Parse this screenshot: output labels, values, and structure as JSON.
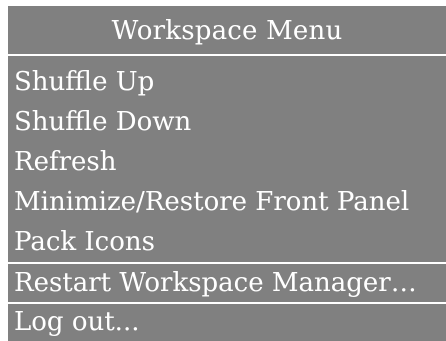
{
  "menu": {
    "title": "Workspace Menu",
    "items": [
      {
        "label": "Shuffle Up",
        "selected": false
      },
      {
        "label": "Shuffle Down",
        "selected": false
      },
      {
        "label": "Refresh",
        "selected": false
      },
      {
        "label": "Minimize/Restore Front Panel",
        "selected": false
      },
      {
        "label": "Pack Icons",
        "selected": false
      },
      {
        "label": "Restart Workspace Manager…",
        "selected": true
      },
      {
        "label": "Log out...",
        "selected": false
      }
    ]
  },
  "colors": {
    "menu_background": "#808080",
    "text": "#ffffff",
    "separator": "#ffffff"
  }
}
